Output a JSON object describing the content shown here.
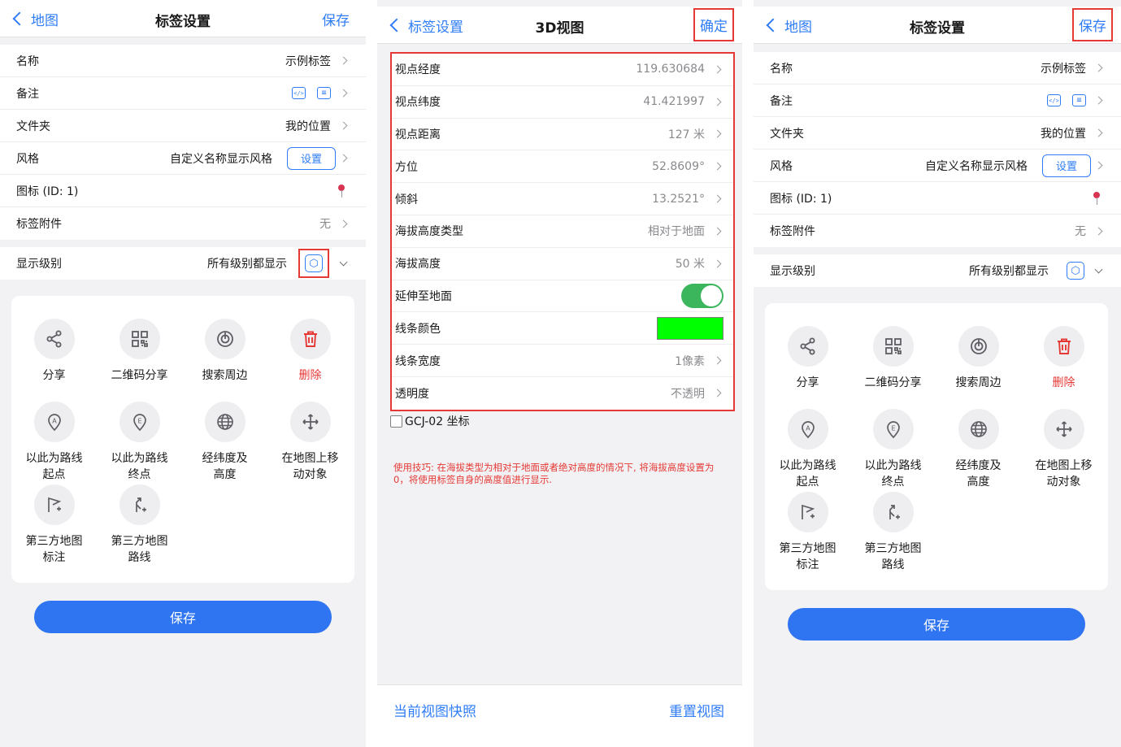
{
  "left": {
    "nav": {
      "back": "地图",
      "title": "标签设置",
      "action": "保存"
    },
    "rows": [
      {
        "label": "名称",
        "value": "示例标签"
      },
      {
        "label": "备注",
        "icon1": "</>",
        "icon2": "≡"
      },
      {
        "label": "文件夹",
        "value": "我的位置"
      },
      {
        "label": "风格",
        "value": "自定义名称显示风格",
        "button": "设置"
      },
      {
        "label": "图标 (ID: 1)"
      },
      {
        "label": "标签附件",
        "value": "无"
      }
    ],
    "level": {
      "label": "显示级别",
      "value": "所有级别都显示"
    },
    "actions": [
      {
        "label": "分享",
        "icon": "share-icon"
      },
      {
        "label": "二维码分享",
        "icon": "qrcode-icon"
      },
      {
        "label": "搜索周边",
        "icon": "radar-icon"
      },
      {
        "label": "删除",
        "icon": "trash-icon"
      },
      {
        "label": "以此为路线\n起点",
        "icon": "route-start-icon"
      },
      {
        "label": "以此为路线\n终点",
        "icon": "route-end-icon"
      },
      {
        "label": "经纬度及\n高度",
        "icon": "globe-icon"
      },
      {
        "label": "在地图上移\n动对象",
        "icon": "move-icon"
      },
      {
        "label": "第三方地图\n标注",
        "icon": "flag-icon"
      },
      {
        "label": "第三方地图\n路线",
        "icon": "route-turn-icon"
      }
    ],
    "save": "保存"
  },
  "middle": {
    "nav": {
      "back": "标签设置",
      "title": "3D视图",
      "action": "确定"
    },
    "rows": [
      {
        "label": "视点经度",
        "value": "119.630684"
      },
      {
        "label": "视点纬度",
        "value": "41.421997"
      },
      {
        "label": "视点距离",
        "value": "127 米"
      },
      {
        "label": "方位",
        "value": "52.8609°"
      },
      {
        "label": "倾斜",
        "value": "13.2521°"
      },
      {
        "label": "海拔高度类型",
        "value": "相对于地面"
      },
      {
        "label": "海拔高度",
        "value": "50 米"
      },
      {
        "label": "延伸至地面"
      },
      {
        "label": "线条颜色"
      },
      {
        "label": "线条宽度",
        "value": "1像素"
      },
      {
        "label": "透明度",
        "value": "不透明"
      }
    ],
    "gcj": "GCJ-02 坐标",
    "tip": "使用技巧: 在海拔类型为相对于地面或者绝对高度的情况下, 将海拔高度设置为0，将使用标签自身的高度值进行显示.",
    "snapshot": "当前视图快照",
    "reset": "重置视图"
  },
  "right": {
    "nav": {
      "back": "地图",
      "title": "标签设置",
      "action": "保存"
    },
    "rows": [
      {
        "label": "名称",
        "value": "示例标签"
      },
      {
        "label": "备注",
        "icon1": "</>",
        "icon2": "≡"
      },
      {
        "label": "文件夹",
        "value": "我的位置"
      },
      {
        "label": "风格",
        "value": "自定义名称显示风格",
        "button": "设置"
      },
      {
        "label": "图标 (ID: 1)"
      },
      {
        "label": "标签附件",
        "value": "无"
      }
    ],
    "level": {
      "label": "显示级别",
      "value": "所有级别都显示"
    },
    "actions": [
      {
        "label": "分享"
      },
      {
        "label": "二维码分享"
      },
      {
        "label": "搜索周边"
      },
      {
        "label": "删除"
      },
      {
        "label": "以此为路线\n起点"
      },
      {
        "label": "以此为路线\n终点"
      },
      {
        "label": "经纬度及\n高度"
      },
      {
        "label": "在地图上移\n动对象"
      },
      {
        "label": "第三方地图\n标注"
      },
      {
        "label": "第三方地图\n路线"
      }
    ],
    "save": "保存"
  },
  "colors": {
    "accent": "#2f7df6",
    "danger": "#e53935",
    "toggle_on": "#3cb65c",
    "line_color": "#00ff00"
  }
}
